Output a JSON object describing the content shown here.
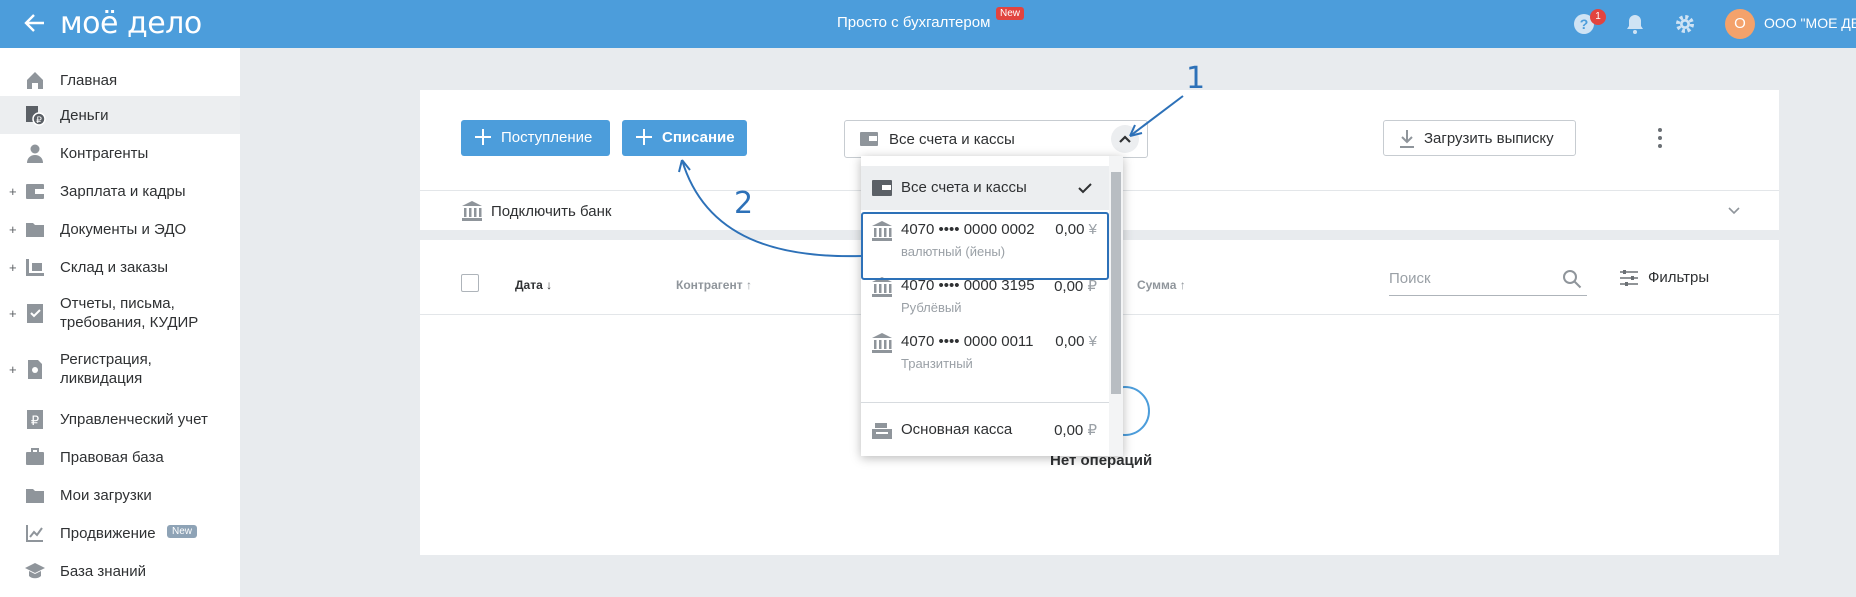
{
  "header": {
    "logo": "моё дело",
    "title": "Просто с бухгалтером",
    "title_badge": "New",
    "help_count": "1",
    "avatar_letter": "О",
    "company": "ООО \"МОЕ ДЕ"
  },
  "sidebar": {
    "items": [
      {
        "label": "Главная",
        "icon": "home-icon"
      },
      {
        "label": "Деньги",
        "icon": "money-icon",
        "active": true
      },
      {
        "label": "Контрагенты",
        "icon": "contractor-icon"
      },
      {
        "label": "Зарплата и кадры",
        "icon": "wallet-icon",
        "expandable": true
      },
      {
        "label": "Документы и ЭДО",
        "icon": "folder-icon",
        "expandable": true
      },
      {
        "label": "Склад и заказы",
        "icon": "warehouse-icon",
        "expandable": true
      },
      {
        "label": "Отчеты, письма, требования, КУДИР",
        "icon": "report-icon",
        "expandable": true
      },
      {
        "label": "Регистрация, ликвидация",
        "icon": "registration-icon",
        "expandable": true
      },
      {
        "label": "Управленческий учет",
        "icon": "ruble-doc-icon"
      },
      {
        "label": "Правовая база",
        "icon": "briefcase-icon"
      },
      {
        "label": "Мои загрузки",
        "icon": "folder-icon"
      },
      {
        "label": "Продвижение",
        "icon": "chart-icon",
        "badge": "New"
      },
      {
        "label": "База знаний",
        "icon": "graduation-cap-icon"
      }
    ]
  },
  "toolbar": {
    "income_label": "Поступление",
    "expense_label": "Списание",
    "account_select": "Все счета и кассы",
    "upload_label": "Загрузить выписку",
    "connect_bank": "Подключить банк"
  },
  "table": {
    "col_date": "Дата",
    "col_contractor": "Контрагент",
    "col_amount": "Сумма",
    "search_placeholder": "Поиск",
    "filters_label": "Фильтры",
    "empty_text": "Нет операций"
  },
  "dropdown": {
    "all_label": "Все счета и кассы",
    "accounts": [
      {
        "number": "4070 •••• 0000 0002",
        "type": "валютный (йены)",
        "amount": "0,00",
        "currency": "¥"
      },
      {
        "number": "4070 •••• 0000 3195",
        "type": "Рублёвый",
        "amount": "0,00",
        "currency": "₽"
      },
      {
        "number": "4070 •••• 0000 0011",
        "type": "Транзитный",
        "amount": "0,00",
        "currency": "¥"
      }
    ],
    "cash": {
      "label": "Основная касса",
      "amount": "0,00",
      "currency": "₽"
    }
  },
  "annotations": {
    "one": "1",
    "two": "2"
  },
  "colors": {
    "brand": "#4c9ddb",
    "annotation": "#2d71b8",
    "alert": "#e2443f"
  }
}
